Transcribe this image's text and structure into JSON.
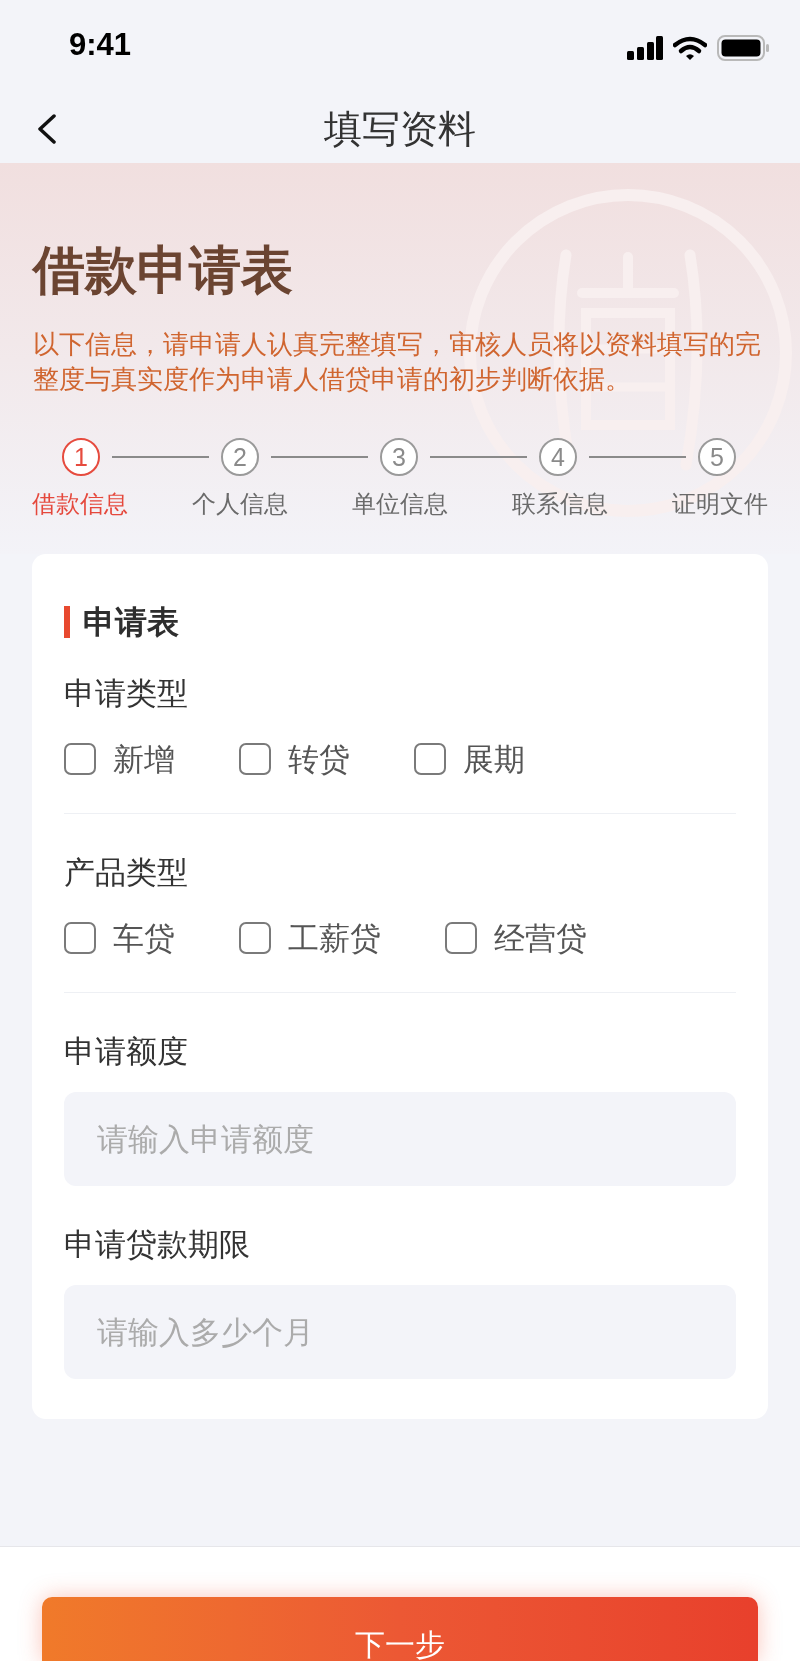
{
  "status_bar": {
    "time": "9:41"
  },
  "nav_bar": {
    "title": "填写资料"
  },
  "header": {
    "title": "借款申请表",
    "description": "以下信息，请申请人认真完整填写，审核人员将以资料填写的完整度与真实度作为申请人借贷申请的初步判断依据。"
  },
  "steps": [
    {
      "number": "1",
      "label": "借款信息",
      "active": true
    },
    {
      "number": "2",
      "label": "个人信息",
      "active": false
    },
    {
      "number": "3",
      "label": "单位信息",
      "active": false
    },
    {
      "number": "4",
      "label": "联系信息",
      "active": false
    },
    {
      "number": "5",
      "label": "证明文件",
      "active": false
    }
  ],
  "form": {
    "title": "申请表",
    "sections": [
      {
        "kind": "checkbox_group",
        "label": "申请类型",
        "options": [
          {
            "label": "新增",
            "checked": false
          },
          {
            "label": "转贷",
            "checked": false
          },
          {
            "label": "展期",
            "checked": false
          }
        ]
      },
      {
        "kind": "checkbox_group",
        "label": "产品类型",
        "options": [
          {
            "label": "车贷",
            "checked": false
          },
          {
            "label": "工薪贷",
            "checked": false
          },
          {
            "label": "经营贷",
            "checked": false
          }
        ]
      },
      {
        "kind": "input",
        "label": "申请额度",
        "placeholder": "请输入申请额度"
      },
      {
        "kind": "input",
        "label": "申请贷款期限",
        "placeholder": "请输入多少个月"
      }
    ]
  },
  "next_button": {
    "label": "下一步"
  }
}
